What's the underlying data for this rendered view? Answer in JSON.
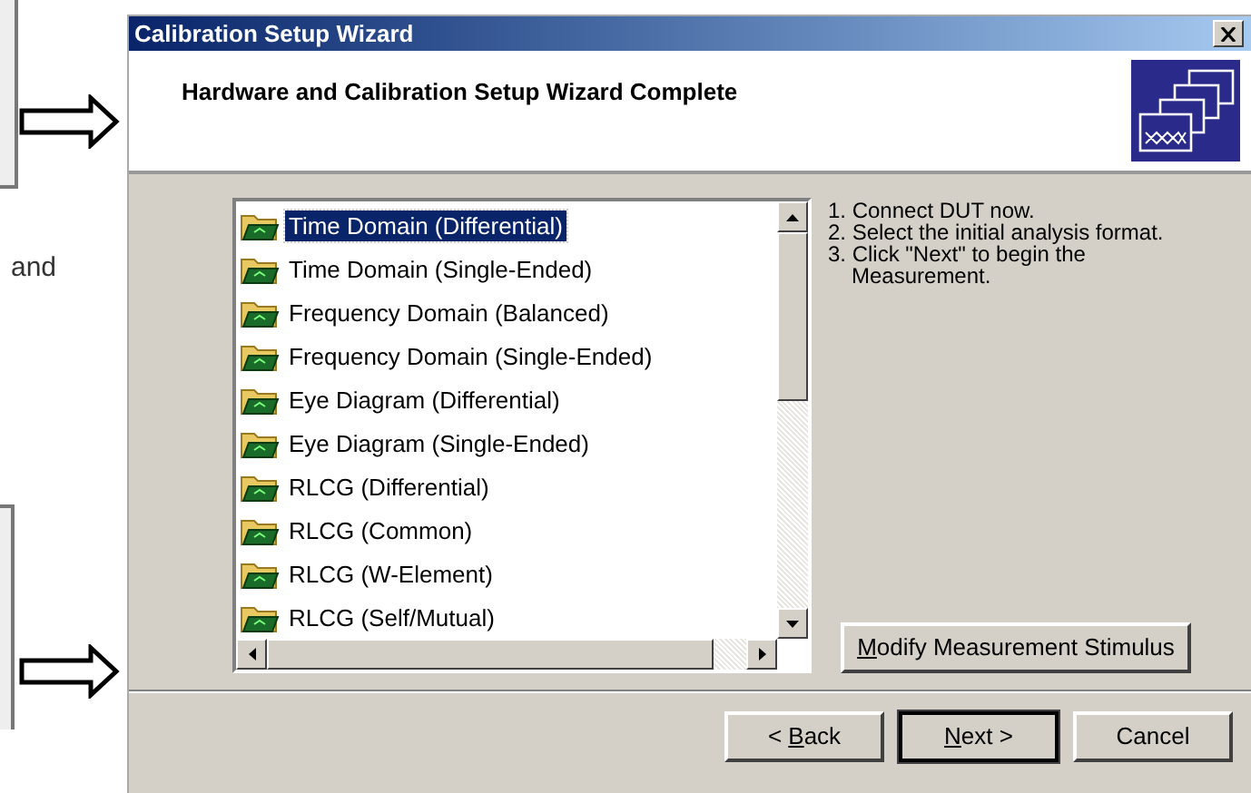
{
  "page": {
    "side_text": "and"
  },
  "window": {
    "title": "Calibration Setup Wizard",
    "heading": "Hardware and Calibration Setup Wizard Complete"
  },
  "formats": [
    {
      "label": "Time Domain (Differential)",
      "selected": true
    },
    {
      "label": "Time Domain (Single-Ended)",
      "selected": false
    },
    {
      "label": "Frequency Domain (Balanced)",
      "selected": false
    },
    {
      "label": "Frequency Domain (Single-Ended)",
      "selected": false
    },
    {
      "label": "Eye Diagram (Differential)",
      "selected": false
    },
    {
      "label": "Eye Diagram (Single-Ended)",
      "selected": false
    },
    {
      "label": "RLCG (Differential)",
      "selected": false
    },
    {
      "label": "RLCG (Common)",
      "selected": false
    },
    {
      "label": "RLCG (W-Element)",
      "selected": false
    },
    {
      "label": "RLCG (Self/Mutual)",
      "selected": false
    }
  ],
  "instructions": [
    "1. Connect DUT now.",
    "2. Select the initial analysis format.",
    "3. Click \"Next\" to begin the Measurement."
  ],
  "modify_button": {
    "label_parts": [
      {
        "text": "M",
        "underlined": true
      },
      {
        "text": "odify Measurement Stimulus",
        "underlined": false
      }
    ]
  },
  "buttons": [
    {
      "label_parts": [
        {
          "text": "< ",
          "underlined": false
        },
        {
          "text": "B",
          "underlined": true
        },
        {
          "text": "ack",
          "underlined": false
        }
      ],
      "default": false
    },
    {
      "label_parts": [
        {
          "text": "N",
          "underlined": true
        },
        {
          "text": "ext >",
          "underlined": false
        }
      ],
      "default": true
    },
    {
      "label_parts": [
        {
          "text": "Cancel",
          "underlined": false
        }
      ],
      "default": false
    }
  ]
}
